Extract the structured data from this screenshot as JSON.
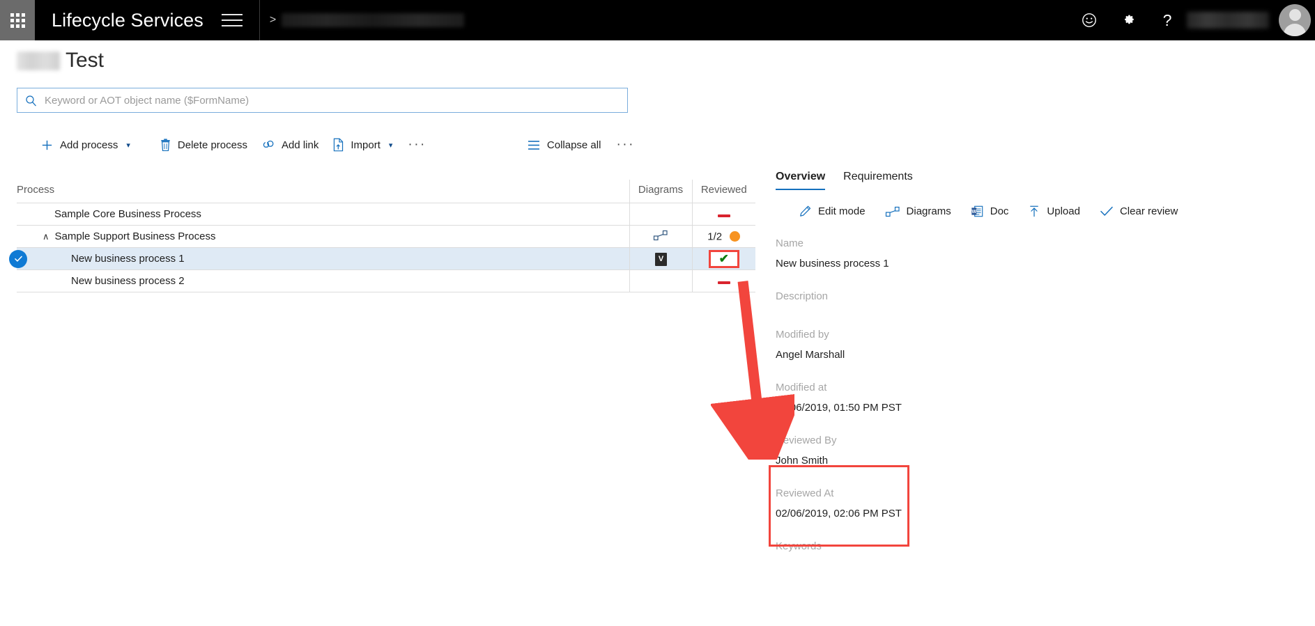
{
  "header": {
    "brand": "Lifecycle Services",
    "waffle_icon": "app-launcher-icon",
    "menu_icon": "hamburger-menu-icon",
    "breadcrumb_separator": ">",
    "breadcrumb_redacted": "",
    "feedback_icon": "smiley-face-icon",
    "settings_icon": "gear-icon",
    "help_icon": "question-mark-icon",
    "username_redacted": "",
    "avatar_icon": "user-avatar-icon"
  },
  "page": {
    "title_prefix_redacted": "",
    "title": "Test"
  },
  "search": {
    "placeholder": "Keyword or AOT object name ($FormName)",
    "value": "",
    "icon": "search-icon"
  },
  "toolbar": {
    "items": [
      {
        "label": "Add process",
        "icon": "plus-icon",
        "has_chevron": true
      },
      {
        "label": "Delete process",
        "icon": "trash-icon",
        "has_chevron": false
      },
      {
        "label": "Add link",
        "icon": "link-icon",
        "has_chevron": false
      },
      {
        "label": "Import",
        "icon": "import-file-icon",
        "has_chevron": true
      }
    ],
    "overflow_label": "···",
    "collapse_all": {
      "label": "Collapse all",
      "icon": "list-lines-icon"
    },
    "right_overflow_label": "···"
  },
  "table": {
    "columns": [
      "Process",
      "Diagrams",
      "Reviewed"
    ],
    "rows": [
      {
        "process": "Sample Core Business Process",
        "indent": 1,
        "selected": false,
        "expandable": false,
        "caret": "",
        "diagrams_icon": "",
        "reviewed_type": "dash",
        "reviewed_text": "",
        "highlighted": false
      },
      {
        "process": "Sample Support Business Process",
        "indent": 2,
        "selected": false,
        "expandable": true,
        "caret": "∧",
        "diagrams_icon": "diagram-shapes-icon",
        "reviewed_type": "fraction",
        "reviewed_text": "1/2",
        "highlighted": false
      },
      {
        "process": "New business process 1",
        "indent": 3,
        "selected": true,
        "expandable": false,
        "caret": "",
        "diagrams_icon": "visio-file-icon",
        "reviewed_type": "check",
        "reviewed_text": "✔",
        "highlighted": true
      },
      {
        "process": "New business process 2",
        "indent": 3,
        "selected": false,
        "expandable": false,
        "caret": "",
        "diagrams_icon": "",
        "reviewed_type": "dash",
        "reviewed_text": "",
        "highlighted": false
      }
    ]
  },
  "panel": {
    "tabs": [
      {
        "label": "Overview",
        "active": true
      },
      {
        "label": "Requirements",
        "active": false
      }
    ],
    "actions": [
      {
        "label": "Edit mode",
        "icon": "pencil-icon"
      },
      {
        "label": "Diagrams",
        "icon": "diagram-shapes-icon"
      },
      {
        "label": "Doc",
        "icon": "word-doc-icon"
      },
      {
        "label": "Upload",
        "icon": "upload-arrow-icon"
      },
      {
        "label": "Clear review",
        "icon": "checkmark-icon"
      }
    ],
    "fields": [
      {
        "label": "Name",
        "value": "New business process 1"
      },
      {
        "label": "Description",
        "value": ""
      },
      {
        "label": "Modified by",
        "value": "Angel Marshall"
      },
      {
        "label": "Modified at",
        "value": "02/06/2019, 01:50 PM PST"
      },
      {
        "label": "Reviewed By",
        "value": "John Smith"
      },
      {
        "label": "Reviewed At",
        "value": "02/06/2019, 02:06 PM PST"
      },
      {
        "label": "Keywords",
        "value": ""
      }
    ]
  },
  "annotations": {
    "highlight_color": "#f2453d",
    "arrow_color": "#f2453d",
    "arrow_description": "red-arrow-from-reviewed-check-to-reviewed-fields"
  },
  "colors": {
    "header_bg": "#000000",
    "waffle_bg": "#6b6b6b",
    "accent_blue": "#0f7ad4",
    "tab_underline": "#1570bd",
    "review_check": "#107c10",
    "dash_red": "#d9232e",
    "dot_orange": "#f79321",
    "row_selected_bg": "#dfeaf5"
  }
}
